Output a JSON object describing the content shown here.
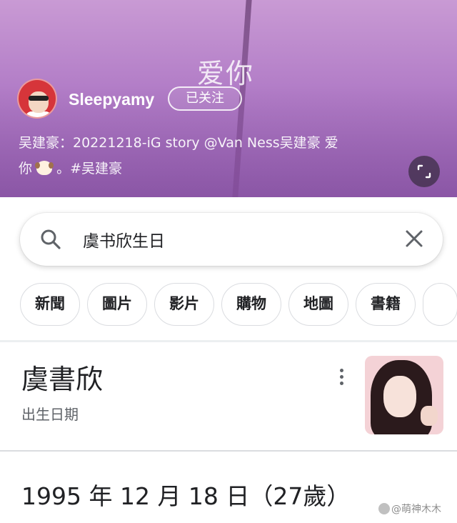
{
  "post": {
    "title": "爱你",
    "username": "Sleepyamy",
    "follow_label": "已关注",
    "caption_line1": "吴建豪：20221218-iG story @Van Ness吴建豪 爱",
    "caption_line2_a": "你",
    "caption_emoji": "dog-face-emoji",
    "caption_line2_b": "。#吴建豪"
  },
  "search": {
    "query": "虞书欣生日",
    "search_icon": "search-icon",
    "clear_icon": "close-icon"
  },
  "chips": [
    "新聞",
    "圖片",
    "影片",
    "購物",
    "地圖",
    "書籍"
  ],
  "result": {
    "name": "虞書欣",
    "subtitle": "出生日期",
    "birth_text": "1995 年 12 月 18 日（27歲）",
    "more_icon": "more-vert-icon"
  },
  "watermark": {
    "text": "@萌神木木"
  },
  "colors": {
    "post_bg": "#b27dc7",
    "text_primary": "#202124",
    "text_secondary": "#5f6368",
    "chip_border": "#dadce0"
  }
}
